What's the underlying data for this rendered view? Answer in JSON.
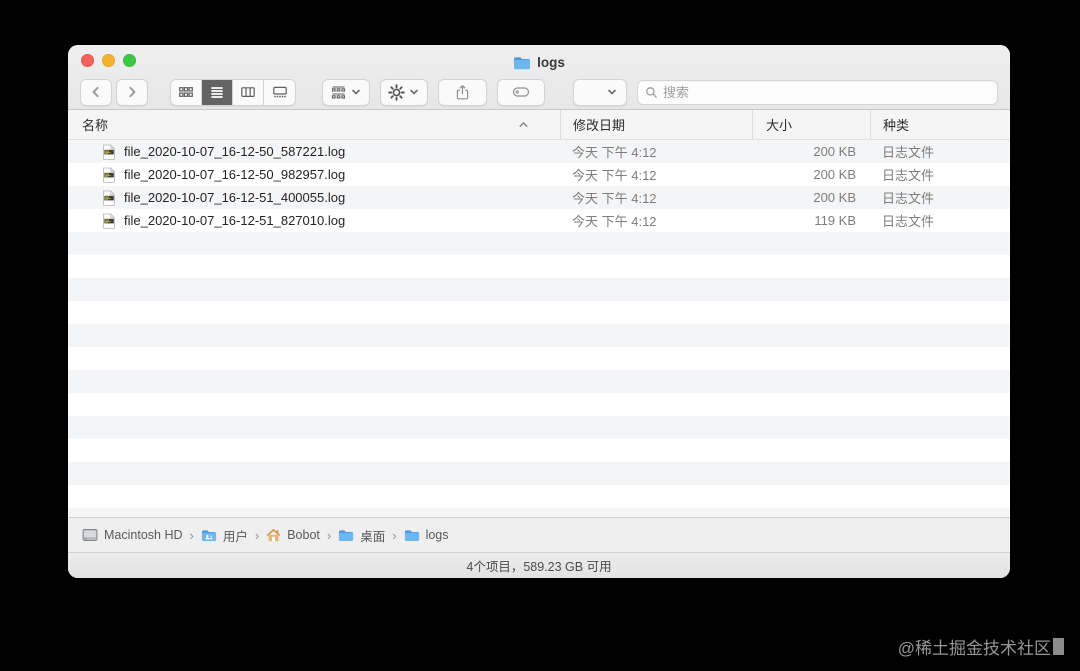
{
  "colors": {
    "traffic_red": "#f4615a",
    "traffic_yellow": "#f1b32e",
    "traffic_green": "#3fc546",
    "folder_blue": "#6cb7ee",
    "selected_segment_bg": "#636363",
    "row_stripe": "#f4f5f6"
  },
  "window": {
    "title": "logs",
    "title_icon": "folder-icon",
    "toolbar": {
      "back_icon": "chevron-left-icon",
      "forward_icon": "chevron-right-icon",
      "view_segments": [
        "icon-view-icon",
        "list-view-icon",
        "column-view-icon",
        "gallery-view-icon"
      ],
      "selected_view": "list",
      "group_button_icon": "group-by-icon",
      "action_button_icon": "gear-icon",
      "share_button_icon": "share-icon",
      "tag_button_icon": "tag-icon",
      "view_options_icon": "chevron-down-icon",
      "search": {
        "icon": "search-icon",
        "placeholder": "搜索"
      }
    },
    "list": {
      "columns": [
        {
          "label": "名称",
          "sort_indicator": "asc"
        },
        {
          "label": "修改日期"
        },
        {
          "label": "大小"
        },
        {
          "label": "种类"
        }
      ],
      "files": [
        {
          "name": "file_2020-10-07_16-12-50_587221.log",
          "date": "今天 下午 4:12",
          "size": "200 KB",
          "kind": "日志文件"
        },
        {
          "name": "file_2020-10-07_16-12-50_982957.log",
          "date": "今天 下午 4:12",
          "size": "200 KB",
          "kind": "日志文件"
        },
        {
          "name": "file_2020-10-07_16-12-51_400055.log",
          "date": "今天 下午 4:12",
          "size": "200 KB",
          "kind": "日志文件"
        },
        {
          "name": "file_2020-10-07_16-12-51_827010.log",
          "date": "今天 下午 4:12",
          "size": "119 KB",
          "kind": "日志文件"
        }
      ]
    },
    "path_bar": {
      "separator": "›",
      "items": [
        {
          "icon": "drive-icon",
          "label": "Macintosh HD"
        },
        {
          "icon": "users-folder-icon",
          "label": "用户"
        },
        {
          "icon": "home-icon",
          "label": "Bobot"
        },
        {
          "icon": "folder-icon",
          "label": "桌面"
        },
        {
          "icon": "folder-icon",
          "label": "logs"
        }
      ]
    },
    "status_bar": {
      "text": "4个项目，589.23 GB 可用"
    }
  },
  "watermark": {
    "text": "@稀土掘金技术社区"
  }
}
